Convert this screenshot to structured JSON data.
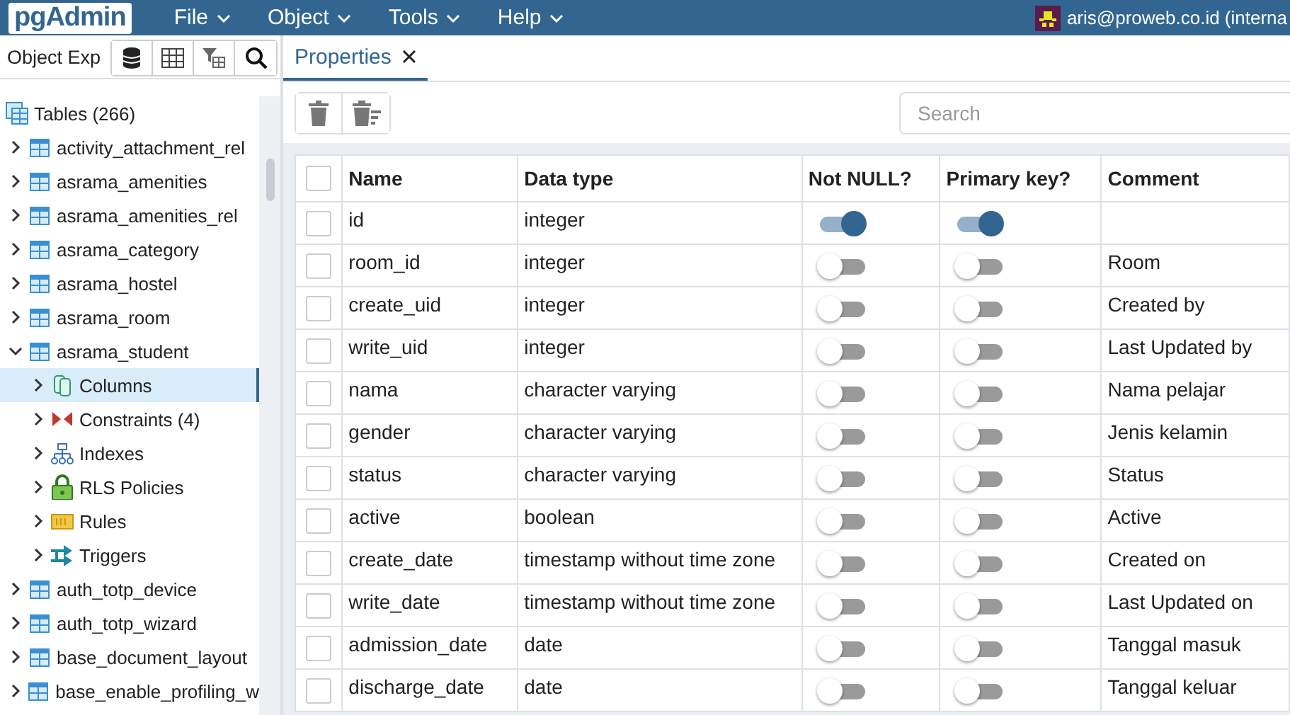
{
  "header": {
    "logo": "pgAdmin",
    "menus": [
      {
        "label": "File"
      },
      {
        "label": "Object"
      },
      {
        "label": "Tools"
      },
      {
        "label": "Help"
      }
    ],
    "user": "aris@proweb.co.id (interna"
  },
  "explorer": {
    "title": "Object Exp",
    "tree": [
      {
        "label": "Tables (266)",
        "kind": "tables",
        "children": [
          {
            "label": "activity_attachment_rel",
            "kind": "table",
            "expanded": false
          },
          {
            "label": "asrama_amenities",
            "kind": "table",
            "expanded": false
          },
          {
            "label": "asrama_amenities_rel",
            "kind": "table",
            "expanded": false
          },
          {
            "label": "asrama_category",
            "kind": "table",
            "expanded": false
          },
          {
            "label": "asrama_hostel",
            "kind": "table",
            "expanded": false
          },
          {
            "label": "asrama_room",
            "kind": "table",
            "expanded": false
          },
          {
            "label": "asrama_student",
            "kind": "table",
            "expanded": true,
            "children": [
              {
                "label": "Columns",
                "kind": "columns",
                "expanded": false,
                "selected": true
              },
              {
                "label": "Constraints (4)",
                "kind": "constraints",
                "expanded": false,
                "selected": false
              },
              {
                "label": "Indexes",
                "kind": "indexes",
                "expanded": false,
                "selected": false
              },
              {
                "label": "RLS Policies",
                "kind": "policies",
                "expanded": false,
                "selected": false
              },
              {
                "label": "Rules",
                "kind": "rules",
                "expanded": false,
                "selected": false
              },
              {
                "label": "Triggers",
                "kind": "triggers",
                "expanded": false,
                "selected": false
              }
            ]
          },
          {
            "label": "auth_totp_device",
            "kind": "table",
            "expanded": false
          },
          {
            "label": "auth_totp_wizard",
            "kind": "table",
            "expanded": false
          },
          {
            "label": "base_document_layout",
            "kind": "table",
            "expanded": false
          },
          {
            "label": "base_enable_profiling_w",
            "kind": "table",
            "expanded": false
          }
        ]
      }
    ]
  },
  "tabs": [
    {
      "label": "Properties",
      "selected": true
    }
  ],
  "search": {
    "placeholder": "Search"
  },
  "table": {
    "select_all": false,
    "columns": [
      "Name",
      "Data type",
      "Not NULL?",
      "Primary key?",
      "Comment"
    ],
    "rows": [
      {
        "checked": false,
        "name": "id",
        "type": "integer",
        "not_null": true,
        "primary_key": true,
        "comment": ""
      },
      {
        "checked": false,
        "name": "room_id",
        "type": "integer",
        "not_null": false,
        "primary_key": false,
        "comment": "Room"
      },
      {
        "checked": false,
        "name": "create_uid",
        "type": "integer",
        "not_null": false,
        "primary_key": false,
        "comment": "Created by"
      },
      {
        "checked": false,
        "name": "write_uid",
        "type": "integer",
        "not_null": false,
        "primary_key": false,
        "comment": "Last Updated by"
      },
      {
        "checked": false,
        "name": "nama",
        "type": "character varying",
        "not_null": false,
        "primary_key": false,
        "comment": "Nama pelajar"
      },
      {
        "checked": false,
        "name": "gender",
        "type": "character varying",
        "not_null": false,
        "primary_key": false,
        "comment": "Jenis kelamin"
      },
      {
        "checked": false,
        "name": "status",
        "type": "character varying",
        "not_null": false,
        "primary_key": false,
        "comment": "Status"
      },
      {
        "checked": false,
        "name": "active",
        "type": "boolean",
        "not_null": false,
        "primary_key": false,
        "comment": "Active"
      },
      {
        "checked": false,
        "name": "create_date",
        "type": "timestamp without time zone",
        "not_null": false,
        "primary_key": false,
        "comment": "Created on"
      },
      {
        "checked": false,
        "name": "write_date",
        "type": "timestamp without time zone",
        "not_null": false,
        "primary_key": false,
        "comment": "Last Updated on"
      },
      {
        "checked": false,
        "name": "admission_date",
        "type": "date",
        "not_null": false,
        "primary_key": false,
        "comment": "Tanggal masuk"
      },
      {
        "checked": false,
        "name": "discharge_date",
        "type": "date",
        "not_null": false,
        "primary_key": false,
        "comment": "Tanggal keluar"
      }
    ]
  }
}
